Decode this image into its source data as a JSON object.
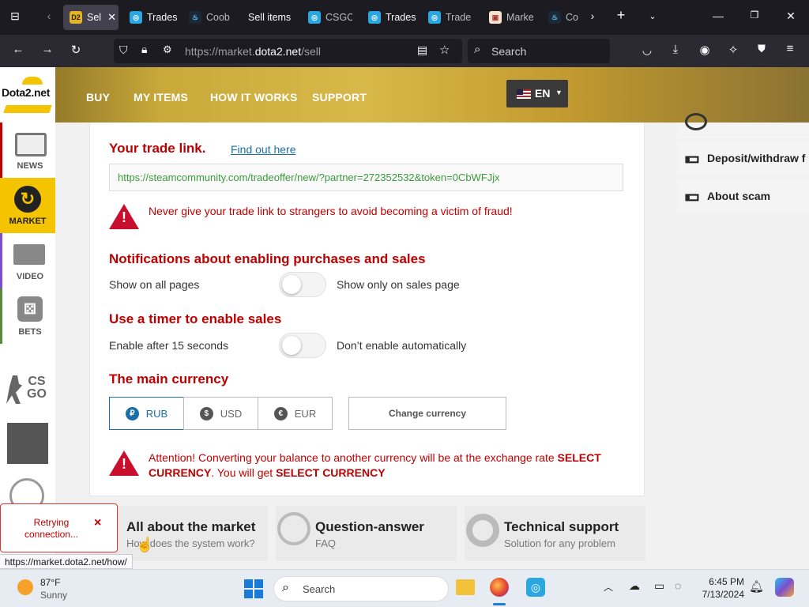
{
  "browser": {
    "tabs": [
      {
        "label": "Sel",
        "icon": "dota2-favicon"
      },
      {
        "label": "Trades",
        "icon": "tradeit-favicon"
      },
      {
        "label": "Coob",
        "icon": "steam-favicon"
      },
      {
        "label": "Sell items",
        "icon": ""
      },
      {
        "label": "CSGO",
        "icon": "tradeit-favicon"
      },
      {
        "label": "Trades",
        "icon": "tradeit-favicon"
      },
      {
        "label": "Trade",
        "icon": "tradeit-favicon"
      },
      {
        "label": "Marke",
        "icon": "market-favicon"
      },
      {
        "label": "Co",
        "icon": "steam-favicon"
      }
    ],
    "url_prefix": "https://market.",
    "url_domain": "dota2.net",
    "url_path": "/sell",
    "search_placeholder": "Search",
    "status_url": "https://market.dota2.net/how/"
  },
  "site": {
    "logo": "Dota2.net",
    "nav": [
      "BUY",
      "MY ITEMS",
      "HOW IT WORKS",
      "SUPPORT"
    ],
    "language": "EN"
  },
  "sidebar": {
    "items": [
      {
        "label": "NEWS",
        "icon": "news-icon"
      },
      {
        "label": "MARKET",
        "icon": "market-icon"
      },
      {
        "label": "VIDEO",
        "icon": "video-icon"
      },
      {
        "label": "BETS",
        "icon": "dice-icon"
      },
      {
        "label": "",
        "icon": "csgo-icon"
      },
      {
        "label": "",
        "icon": "rust-icon"
      },
      {
        "label": "",
        "icon": "tf2-icon"
      }
    ],
    "csgo_text": "CS\nGO"
  },
  "trade": {
    "heading": "Your trade link.",
    "find_link": "Find out here",
    "link_value": "https://steamcommunity.com/tradeoffer/new/?partner=272352532&token=0CbWFJjx",
    "warning": "Never give your trade link to strangers to avoid becoming a victim of fraud!"
  },
  "notifications": {
    "heading": "Notifications about enabling purchases and sales",
    "left": "Show on all pages",
    "right": "Show only on sales page"
  },
  "timer": {
    "heading": "Use a timer to enable sales",
    "left": "Enable after 15 seconds",
    "right": "Don’t enable automatically"
  },
  "currency": {
    "heading": "The main currency",
    "options": [
      {
        "label": "RUB",
        "symbol": "₽"
      },
      {
        "label": "USD",
        "symbol": "$"
      },
      {
        "label": "EUR",
        "symbol": "€"
      }
    ],
    "selected": "RUB",
    "change_button": "Change currency",
    "warning_part1": "Attention! Converting your balance to another currency will be at the exchange rate ",
    "warning_bold1": "SELECT",
    "warning_bold1b": "CURRENCY",
    "warning_part2": ". You will get ",
    "warning_bold2": "SELECT CURRENCY"
  },
  "right_panel": {
    "items": [
      "Deposit/withdraw f",
      "About scam"
    ]
  },
  "bottom_tiles": [
    {
      "title": "All about the market",
      "subtitle": "How does the system work?"
    },
    {
      "title": "Question-answer",
      "subtitle": "FAQ"
    },
    {
      "title": "Technical support",
      "subtitle": "Solution for any problem"
    }
  ],
  "toast": {
    "text": "Retrying connection...",
    "close": "×"
  },
  "taskbar": {
    "temperature": "87°F",
    "weather": "Sunny",
    "search": "Search",
    "time": "6:45 PM",
    "date": "7/13/2024"
  },
  "colors": {
    "accent_red": "#c00000",
    "link_teal": "#1a6fa8",
    "active_tab": "#42414d",
    "header_gold": "#d8b849",
    "market_yellow": "#f5c400"
  }
}
